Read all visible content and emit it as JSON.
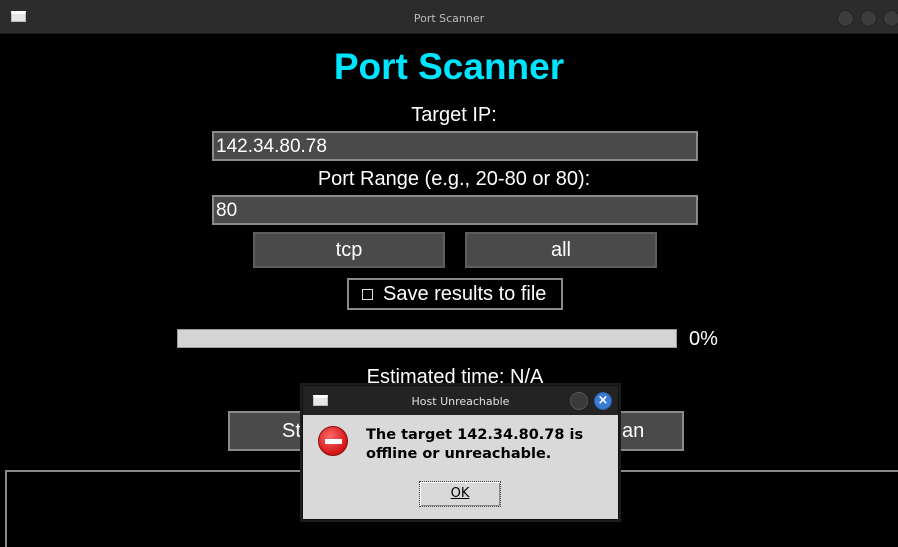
{
  "window": {
    "title": "Port Scanner",
    "app_title": "Port Scanner",
    "accent_color": "#00e5ff"
  },
  "form": {
    "target_label": "Target IP:",
    "target_value": "142.34.80.78",
    "range_label": "Port Range (e.g., 20-80 or 80):",
    "range_value": "80",
    "protocol_option": "tcp",
    "scan_mode_option": "all",
    "save_checkbox_label": "Save results to file",
    "save_checked": false
  },
  "progress": {
    "value_fraction": 0,
    "text": "0%",
    "estimated_time": "Estimated time: N/A"
  },
  "actions": {
    "start_label": "St",
    "scan_label": "an"
  },
  "dialog": {
    "title": "Host Unreachable",
    "message": "The target 142.34.80.78 is offline or unreachable.",
    "ok_label": "OK",
    "icon": "error-icon",
    "close_icon": "close-icon"
  }
}
